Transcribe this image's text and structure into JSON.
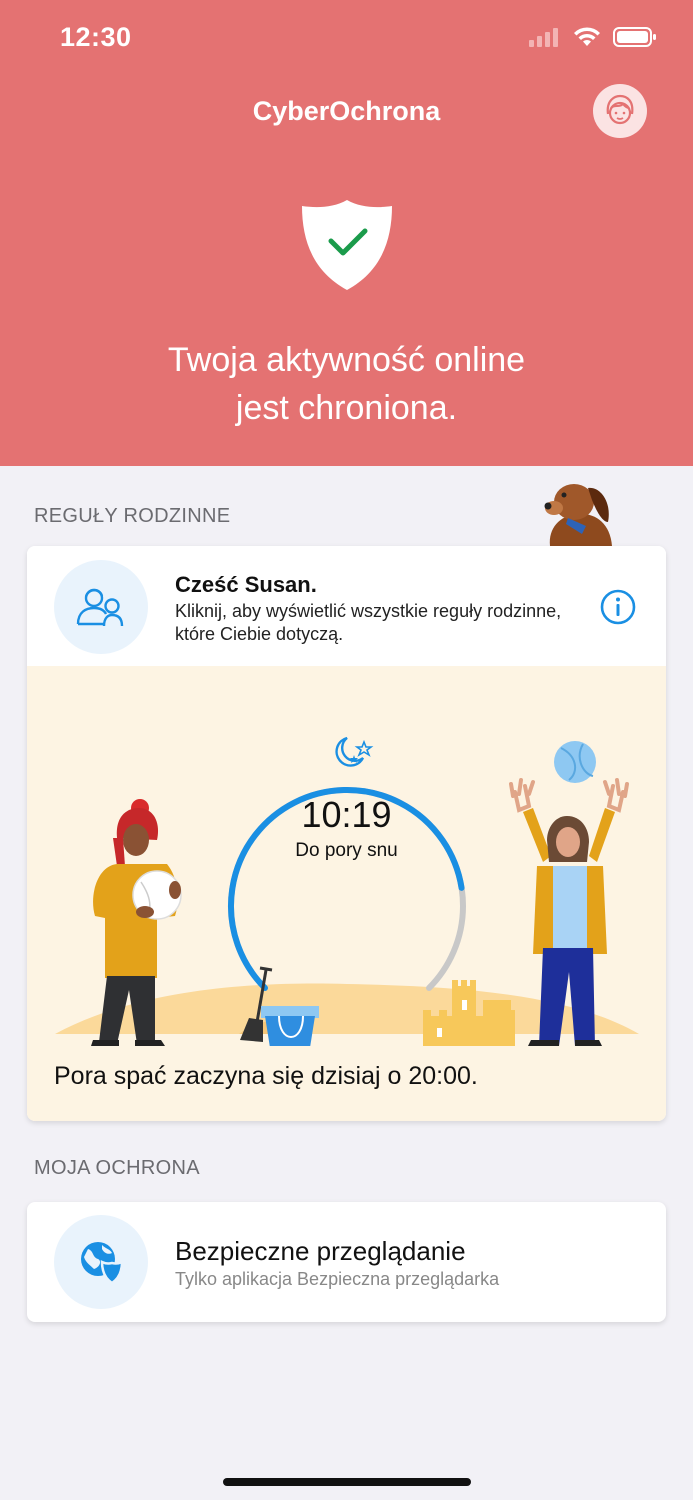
{
  "status_bar": {
    "time": "12:30"
  },
  "header": {
    "title": "CyberOchrona",
    "status_message_line1": "Twoja aktywność online",
    "status_message_line2": "jest chroniona."
  },
  "family_rules": {
    "section_label": "REGUŁY RODZINNE",
    "greeting": "Cześć Susan.",
    "description": "Kliknij, aby wyświetlić wszystkie reguły rodzinne, które Ciebie dotyczą.",
    "timer": {
      "time": "10:19",
      "label": "Do pory snu",
      "progress": 0.8
    },
    "bedtime_message": "Pora spać zaczyna się dzisiaj o 20:00."
  },
  "my_protection": {
    "section_label": "MOJA OCHRONA",
    "items": [
      {
        "title": "Bezpieczne przeglądanie",
        "subtitle": "Tylko aplikacja Bezpieczna przeglądarka",
        "icon": "globe-shield-icon"
      }
    ]
  },
  "colors": {
    "accent_red": "#e47272",
    "accent_blue": "#1a8fe3",
    "cream": "#fdf4e3"
  }
}
